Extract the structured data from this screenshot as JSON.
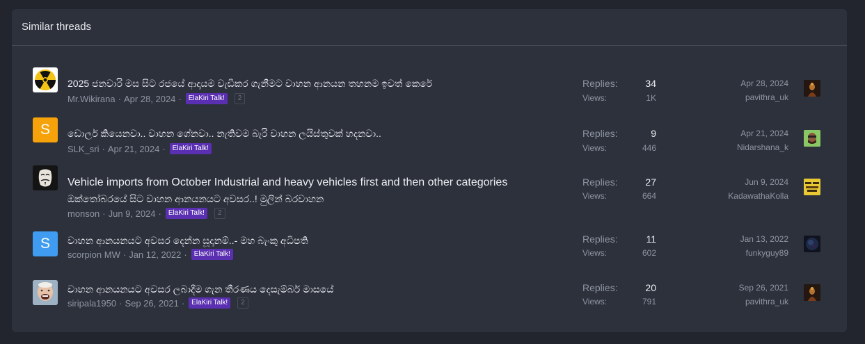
{
  "header": {
    "title": "Similar threads"
  },
  "labels": {
    "replies": "Replies:",
    "views": "Views:"
  },
  "threads": [
    {
      "title": "2025 ජනවාරි මස සිට රජයේ ආදායම වැඩිකර ගැනීමට වාහන ආනයන තහනම ඉවත් කෙරේ",
      "subtitle": "",
      "author": "Mr.Wikirana",
      "date": "Apr 28, 2024",
      "tag": "ElaKiri Talk!",
      "pages": "2",
      "replies": "34",
      "views": "1K",
      "last_date": "Apr 28, 2024",
      "last_user": "pavithra_uk",
      "avatar_icon": "radiation-icon"
    },
    {
      "title": "ඩොලර් කියෙනවා.. වාහන ගේනවා.. නැතිවම බැරි වාහන ලයිස්තුවක් හදනවා..",
      "subtitle": "",
      "author": "SLK_sri",
      "date": "Apr 21, 2024",
      "tag": "ElaKiri Talk!",
      "pages": "",
      "replies": "9",
      "views": "446",
      "last_date": "Apr 21, 2024",
      "last_user": "Nidarshana_k",
      "avatar_letter": "S",
      "avatar_color": "#f5a20b"
    },
    {
      "title": "Vehicle imports from October Industrial and heavy vehicles first and then other categories",
      "subtitle": "ඔක්තෝබරයේ සිට වාහන ආනයනයට අවසර..! මුලින් බරවාහන",
      "author": "monson",
      "date": "Jun 9, 2024",
      "tag": "ElaKiri Talk!",
      "pages": "2",
      "replies": "27",
      "views": "664",
      "last_date": "Jun 9, 2024",
      "last_user": "KadawathaKolla",
      "avatar_icon": "mask-icon"
    },
    {
      "title": "වාහන ආනයනයට අවසර දෙන්න සූදානම්..- මහ බැංකු අධිපති",
      "subtitle": "",
      "author": "scorpion MW",
      "date": "Jan 12, 2022",
      "tag": "ElaKiri Talk!",
      "pages": "",
      "replies": "11",
      "views": "602",
      "last_date": "Jan 13, 2022",
      "last_user": "funkyguy89",
      "avatar_letter": "S",
      "avatar_color": "#3f9cf0"
    },
    {
      "title": "වාහන ආනයනයට අවසර ලබාදීම ගැන තීරණය දෙසැම්බර් මාසයේ",
      "subtitle": "",
      "author": "siripala1950",
      "date": "Sep 26, 2021",
      "tag": "ElaKiri Talk!",
      "pages": "2",
      "replies": "20",
      "views": "791",
      "last_date": "Sep 26, 2021",
      "last_user": "pavithra_uk",
      "avatar_icon": "photo-avatar-icon"
    }
  ]
}
